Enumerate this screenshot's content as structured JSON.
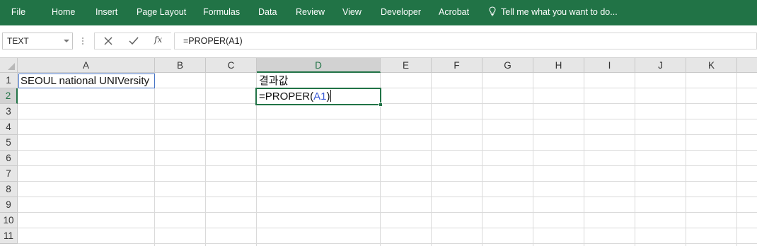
{
  "ribbon": {
    "tabs": [
      "File",
      "Home",
      "Insert",
      "Page Layout",
      "Formulas",
      "Data",
      "Review",
      "View",
      "Developer",
      "Acrobat"
    ],
    "tell_me": "Tell me what you want to do...",
    "tell_me_icon": "lightbulb-icon",
    "color": "#217346"
  },
  "formula_bar": {
    "name_box": "TEXT",
    "cancel_icon": "close-icon",
    "enter_icon": "checkmark-icon",
    "function_label": "fx",
    "formula": "=PROPER(A1)"
  },
  "grid": {
    "columns": [
      "A",
      "B",
      "C",
      "D",
      "E",
      "F",
      "G",
      "H",
      "I",
      "J",
      "K"
    ],
    "rows": [
      "1",
      "2",
      "3",
      "4",
      "5",
      "6",
      "7",
      "8",
      "9",
      "10",
      "11"
    ],
    "selected_column": "D",
    "selected_row": "2",
    "cells": {
      "A1": "SEOUL national UNIVersity",
      "D1": "결과값",
      "D2_prefix": "=PROPER(",
      "D2_ref": "A1",
      "D2_suffix": ")"
    },
    "ref_color": "#3b5bd6"
  }
}
